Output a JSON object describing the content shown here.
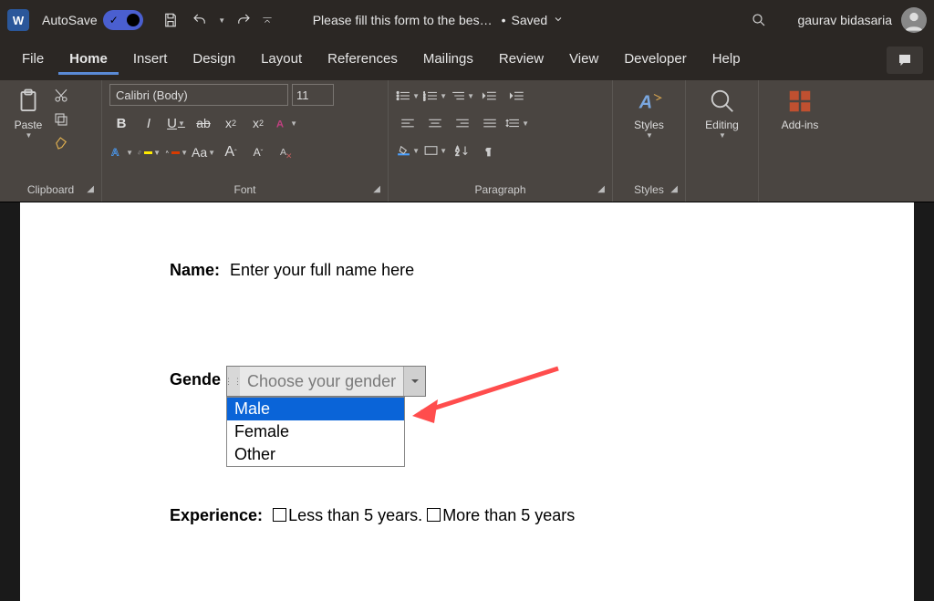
{
  "titlebar": {
    "autosave_label": "AutoSave",
    "doc_title": "Please fill this form to the bes…",
    "saved_label": "Saved",
    "user_name": "gaurav bidasaria"
  },
  "tabs": {
    "items": [
      "File",
      "Home",
      "Insert",
      "Design",
      "Layout",
      "References",
      "Mailings",
      "Review",
      "View",
      "Developer",
      "Help"
    ],
    "active_index": 1
  },
  "ribbon": {
    "clipboard": {
      "paste_label": "Paste",
      "group_label": "Clipboard"
    },
    "font": {
      "group_label": "Font",
      "font_name": "Calibri (Body)",
      "font_size": "11",
      "bold": "B",
      "italic": "I",
      "underline": "U",
      "strike": "ab",
      "subscript": "x",
      "subscript_n": "2",
      "superscript": "x",
      "superscript_n": "2",
      "aa": "Aa",
      "grow": "A",
      "shrink": "A"
    },
    "paragraph": {
      "group_label": "Paragraph"
    },
    "styles": {
      "big_label": "Styles",
      "group_label": "Styles"
    },
    "editing": {
      "big_label": "Editing"
    },
    "addins": {
      "big_label": "Add-ins"
    }
  },
  "doc": {
    "name_label": "Name:",
    "name_placeholder": "Enter your full name here",
    "gender_label": "Gende",
    "gender_placeholder": "Choose your gender",
    "gender_options": [
      "Male",
      "Female",
      "Other"
    ],
    "gender_selected_index": 0,
    "experience_label": "Experience:",
    "experience_opt1": "Less than 5 years.",
    "experience_opt2": "More than 5 years"
  }
}
